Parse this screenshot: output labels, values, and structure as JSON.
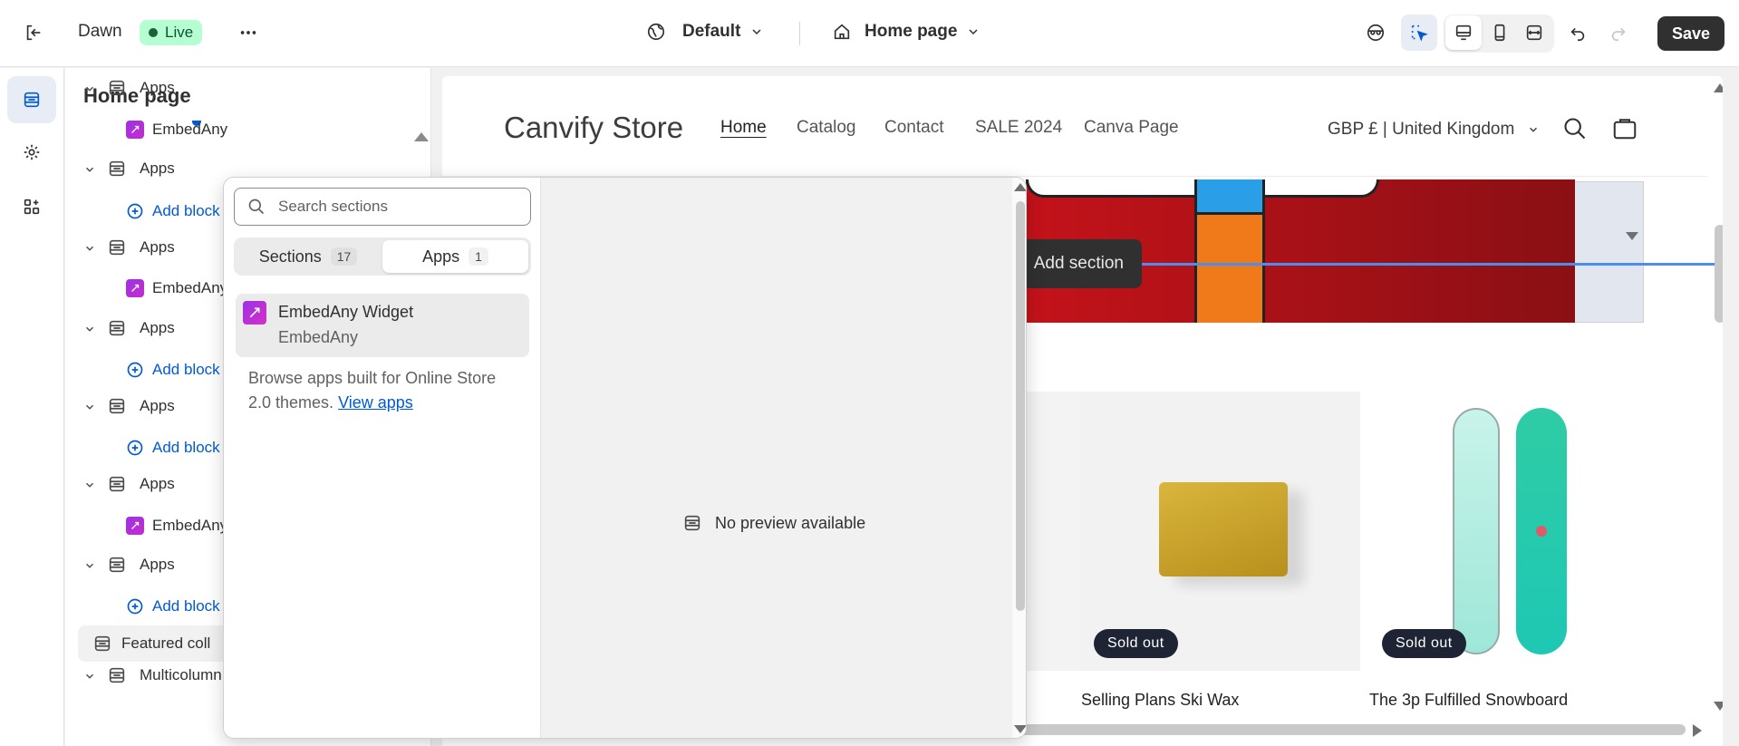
{
  "topbar": {
    "theme_name": "Dawn",
    "live_label": "Live",
    "view_dropdown": "Default",
    "page_dropdown": "Home page",
    "save_label": "Save"
  },
  "sidebar": {
    "title": "Home page",
    "rows": [
      {
        "type": "section",
        "label": "Apps"
      },
      {
        "type": "app",
        "label": "EmbedAny"
      },
      {
        "type": "section",
        "label": "Apps"
      },
      {
        "type": "add",
        "label": "Add block"
      },
      {
        "type": "section",
        "label": "Apps"
      },
      {
        "type": "app",
        "label": "EmbedAny"
      },
      {
        "type": "section",
        "label": "Apps"
      },
      {
        "type": "add",
        "label": "Add block"
      },
      {
        "type": "section",
        "label": "Apps"
      },
      {
        "type": "add",
        "label": "Add block"
      },
      {
        "type": "section",
        "label": "Apps"
      },
      {
        "type": "app",
        "label": "EmbedAny"
      },
      {
        "type": "section",
        "label": "Apps"
      },
      {
        "type": "add",
        "label": "Add block"
      },
      {
        "type": "featured",
        "label": "Featured coll"
      },
      {
        "type": "section",
        "label": "Multicolumn"
      }
    ]
  },
  "picker": {
    "search_placeholder": "Search sections",
    "tabs": [
      {
        "label": "Sections",
        "count": "17"
      },
      {
        "label": "Apps",
        "count": "1"
      }
    ],
    "active_tab": "Apps",
    "app_card": {
      "name": "EmbedAny Widget",
      "vendor": "EmbedAny"
    },
    "browse_text": "Browse apps built for Online Store 2.0 themes.",
    "browse_link": "View apps",
    "no_preview": "No preview available"
  },
  "store": {
    "logo": "Canvify Store",
    "nav": [
      "Home",
      "Catalog",
      "Contact",
      "SALE 2024",
      "Canva Page"
    ],
    "currency": "GBP £ | United Kingdom",
    "add_section": "Add section",
    "products": [
      {
        "title": "Selling Plans Ski Wax",
        "badge": "Sold out"
      },
      {
        "title": "The 3p Fulfilled Snowboard",
        "badge": "Sold out"
      }
    ]
  },
  "colors": {
    "accent_blue": "#005bd3",
    "live_bg": "#b4fed2",
    "save_bg": "#303030",
    "app_gradient": "#9b32e6"
  }
}
